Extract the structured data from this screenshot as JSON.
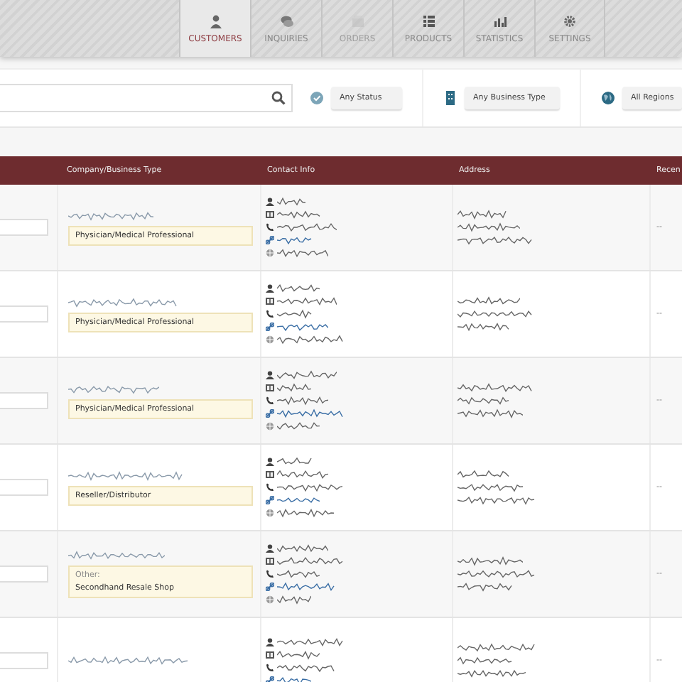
{
  "nav": {
    "tabs": [
      {
        "label": "CUSTOMERS",
        "kind": "person",
        "selected": true,
        "disabled": false
      },
      {
        "label": "INQUIRIES",
        "kind": "chat",
        "selected": false,
        "disabled": false
      },
      {
        "label": "ORDERS",
        "kind": "box",
        "selected": false,
        "disabled": true
      },
      {
        "label": "PRODUCTS",
        "kind": "list",
        "selected": false,
        "disabled": false
      },
      {
        "label": "STATISTICS",
        "kind": "chart",
        "selected": false,
        "disabled": false
      },
      {
        "label": "SETTINGS",
        "kind": "gear",
        "selected": false,
        "disabled": false
      }
    ]
  },
  "filters": [
    {
      "kind": "status",
      "value": "Any Status"
    },
    {
      "kind": "business",
      "value": "Any Business Type"
    },
    {
      "kind": "region",
      "value": "All Regions"
    }
  ],
  "table": {
    "columns": [
      "Company/Business Type",
      "Contact Info",
      "Address",
      "Recen"
    ],
    "rows": [
      {
        "business_type": "Physician/Medical Professional",
        "recent": "--"
      },
      {
        "business_type": "Physician/Medical Professional",
        "recent": "--"
      },
      {
        "business_type": "Physician/Medical Professional",
        "recent": "--"
      },
      {
        "business_type": "Reseller/Distributor",
        "recent": "--"
      },
      {
        "type_note": "Other:",
        "business_type": "Secondhand Resale Shop",
        "recent": "--"
      },
      {
        "recent": "--"
      }
    ]
  }
}
